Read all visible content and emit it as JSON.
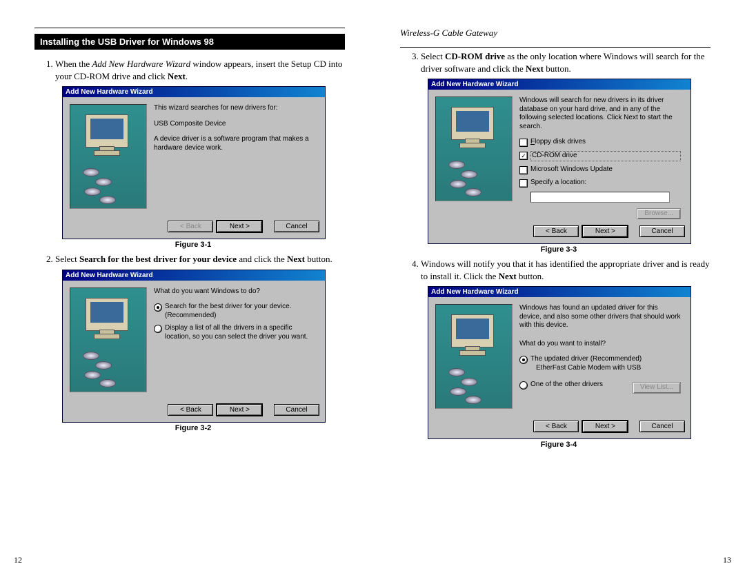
{
  "left": {
    "section_title": "Installing the USB Driver for Windows 98",
    "step1_pre": "When the ",
    "step1_italic": "Add New Hardware Wizard",
    "step1_mid": " window appears, insert the Setup CD into your CD-ROM drive and click ",
    "step1_bold": "Next",
    "step1_post": ".",
    "fig1": {
      "title": "Add New Hardware Wizard",
      "line1": "This wizard searches for new drivers for:",
      "line2": "USB Composite Device",
      "line3": "A device driver is a software program that makes a hardware device work.",
      "btn_back": "< Back",
      "btn_next": "Next >",
      "btn_cancel": "Cancel",
      "caption": "Figure 3-1"
    },
    "step2_pre": "Select ",
    "step2_bold1": "Search for the best driver for your device",
    "step2_mid": " and click the ",
    "step2_bold2": "Next",
    "step2_post": " button.",
    "fig2": {
      "title": "Add New Hardware Wizard",
      "prompt": "What do you want Windows to do?",
      "opt1a": "Search for the best driver for your device.",
      "opt1b": "(Recommended)",
      "opt2": "Display a list of all the drivers in a specific location, so you can select the driver you want.",
      "btn_back": "< Back",
      "btn_next": "Next >",
      "btn_cancel": "Cancel",
      "caption": "Figure 3-2"
    },
    "pagenum": "12"
  },
  "right": {
    "product": "Wireless-G Cable Gateway",
    "step3_pre": "Select ",
    "step3_bold1": "CD-ROM drive",
    "step3_mid": " as the only location where Windows will search for the driver software and click the ",
    "step3_bold2": "Next",
    "step3_post": " button.",
    "fig3": {
      "title": "Add New Hardware Wizard",
      "intro": "Windows will search for new drivers in its driver database on your hard drive, and in any of the following selected locations. Click Next to start the search.",
      "opt1": "Floppy disk drives",
      "opt2": "CD-ROM drive",
      "opt3": "Microsoft Windows Update",
      "opt4": "Specify a location:",
      "browse": "Browse...",
      "btn_back": "< Back",
      "btn_next": "Next >",
      "btn_cancel": "Cancel",
      "caption": "Figure 3-3"
    },
    "step4_pre": "Windows will notify you that it has identified the appropriate driver and is ready to install it. Click the ",
    "step4_bold": "Next",
    "step4_post": " button.",
    "fig4": {
      "title": "Add New Hardware Wizard",
      "intro": "Windows has found an updated driver for this device, and also some other drivers that should work with this device.",
      "prompt": "What do you want to install?",
      "opt1a": "The updated driver (Recommended)",
      "opt1b": "EtherFast Cable Modem with USB",
      "opt2": "One of the other drivers",
      "viewlist": "View List...",
      "btn_back": "< Back",
      "btn_next": "Next >",
      "btn_cancel": "Cancel",
      "caption": "Figure 3-4"
    },
    "pagenum": "13"
  }
}
